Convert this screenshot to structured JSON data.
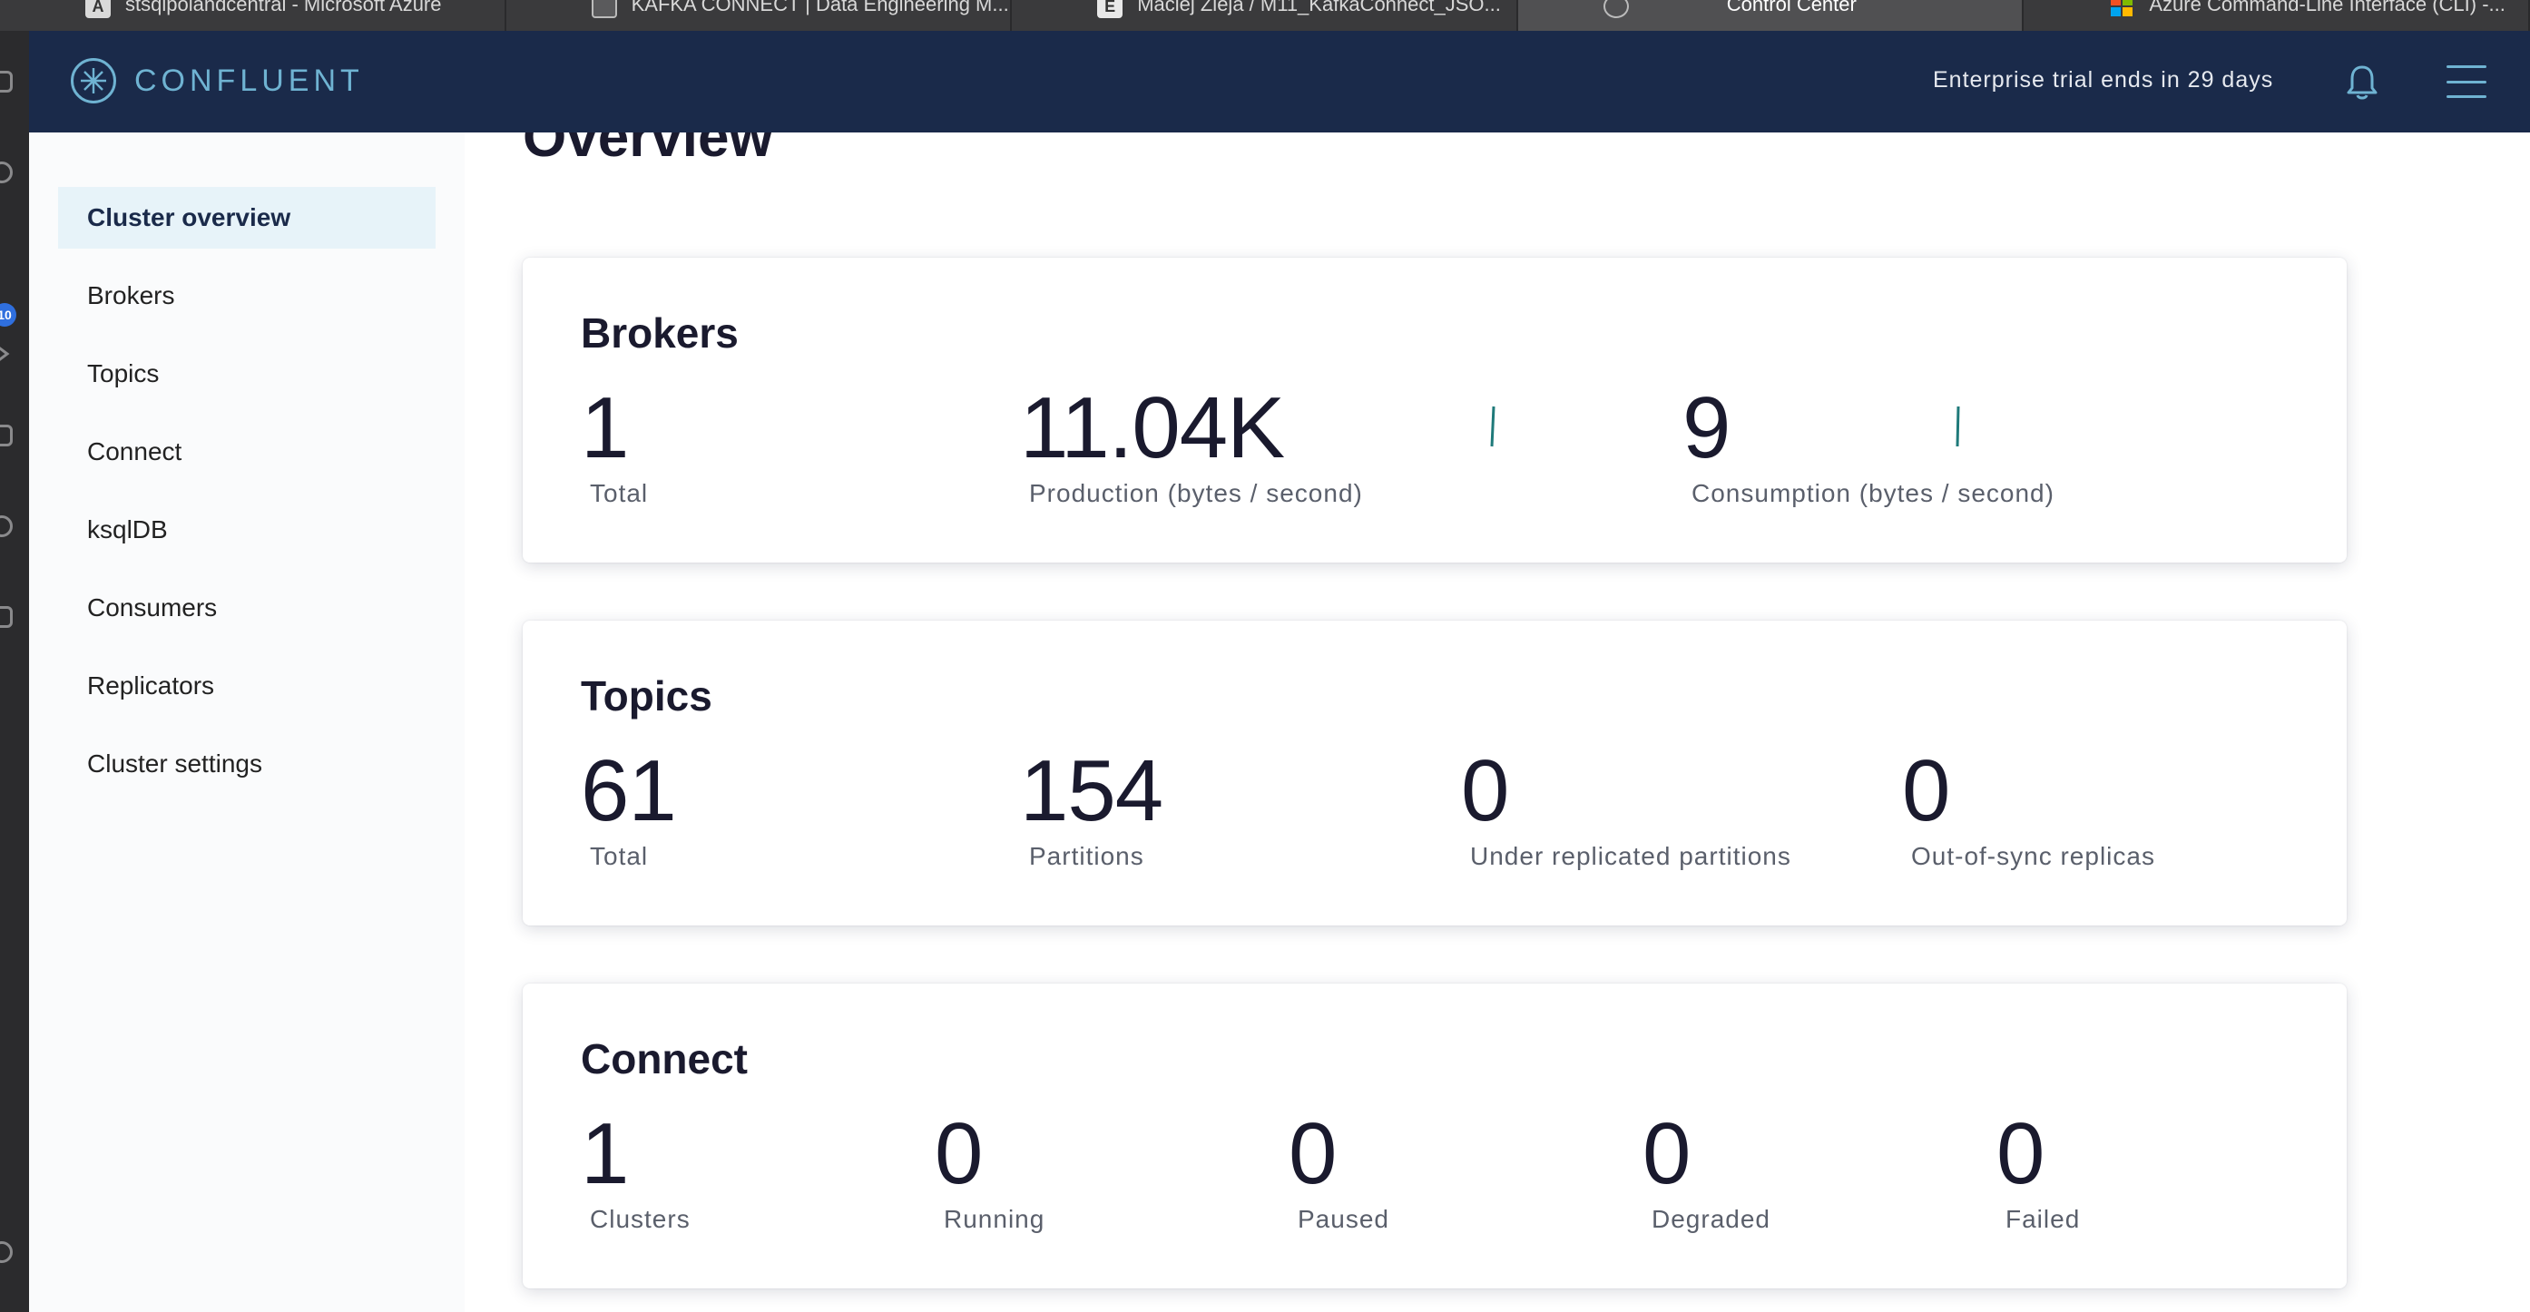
{
  "browser_tabs": [
    {
      "title": "stsqlpolandcentral - Microsoft Azure",
      "icon": "azure-icon",
      "icon_text": "A"
    },
    {
      "title": "KAFKA CONNECT | Data Engineering M...",
      "icon": "document-icon"
    },
    {
      "title": "Maciej Zieja / M11_KafkaConnect_JSO...",
      "icon": "github-icon",
      "icon_text": "E"
    },
    {
      "title": "Control Center",
      "icon": "confluent-icon",
      "active": true
    },
    {
      "title": "Azure Command-Line Interface (CLI) -...",
      "icon": "microsoft-icon"
    }
  ],
  "dock": {
    "badge": "10"
  },
  "header": {
    "logo_text": "CONFLUENT",
    "trial_notice": "Enterprise trial ends in 29 days",
    "colors": {
      "background": "#1a2a4a",
      "accent": "#6fb3d2"
    }
  },
  "sidebar": {
    "items": [
      {
        "label": "Cluster overview",
        "active": true
      },
      {
        "label": "Brokers"
      },
      {
        "label": "Topics"
      },
      {
        "label": "Connect"
      },
      {
        "label": "ksqlDB"
      },
      {
        "label": "Consumers"
      },
      {
        "label": "Replicators"
      },
      {
        "label": "Cluster settings"
      }
    ]
  },
  "page": {
    "title": "Overview"
  },
  "brokers": {
    "title": "Brokers",
    "metrics": [
      {
        "value": "1",
        "label": "Total"
      },
      {
        "value": "11.04K",
        "label": "Production (bytes / second)"
      },
      {
        "value": "9",
        "label": "Consumption (bytes / second)"
      }
    ],
    "sparkline_color": "#1f7a7a"
  },
  "topics": {
    "title": "Topics",
    "metrics": [
      {
        "value": "61",
        "label": "Total"
      },
      {
        "value": "154",
        "label": "Partitions"
      },
      {
        "value": "0",
        "label": "Under replicated partitions"
      },
      {
        "value": "0",
        "label": "Out-of-sync replicas"
      }
    ]
  },
  "connect": {
    "title": "Connect",
    "metrics": [
      {
        "value": "1",
        "label": "Clusters"
      },
      {
        "value": "0",
        "label": "Running"
      },
      {
        "value": "0",
        "label": "Paused"
      },
      {
        "value": "0",
        "label": "Degraded"
      },
      {
        "value": "0",
        "label": "Failed"
      }
    ]
  }
}
